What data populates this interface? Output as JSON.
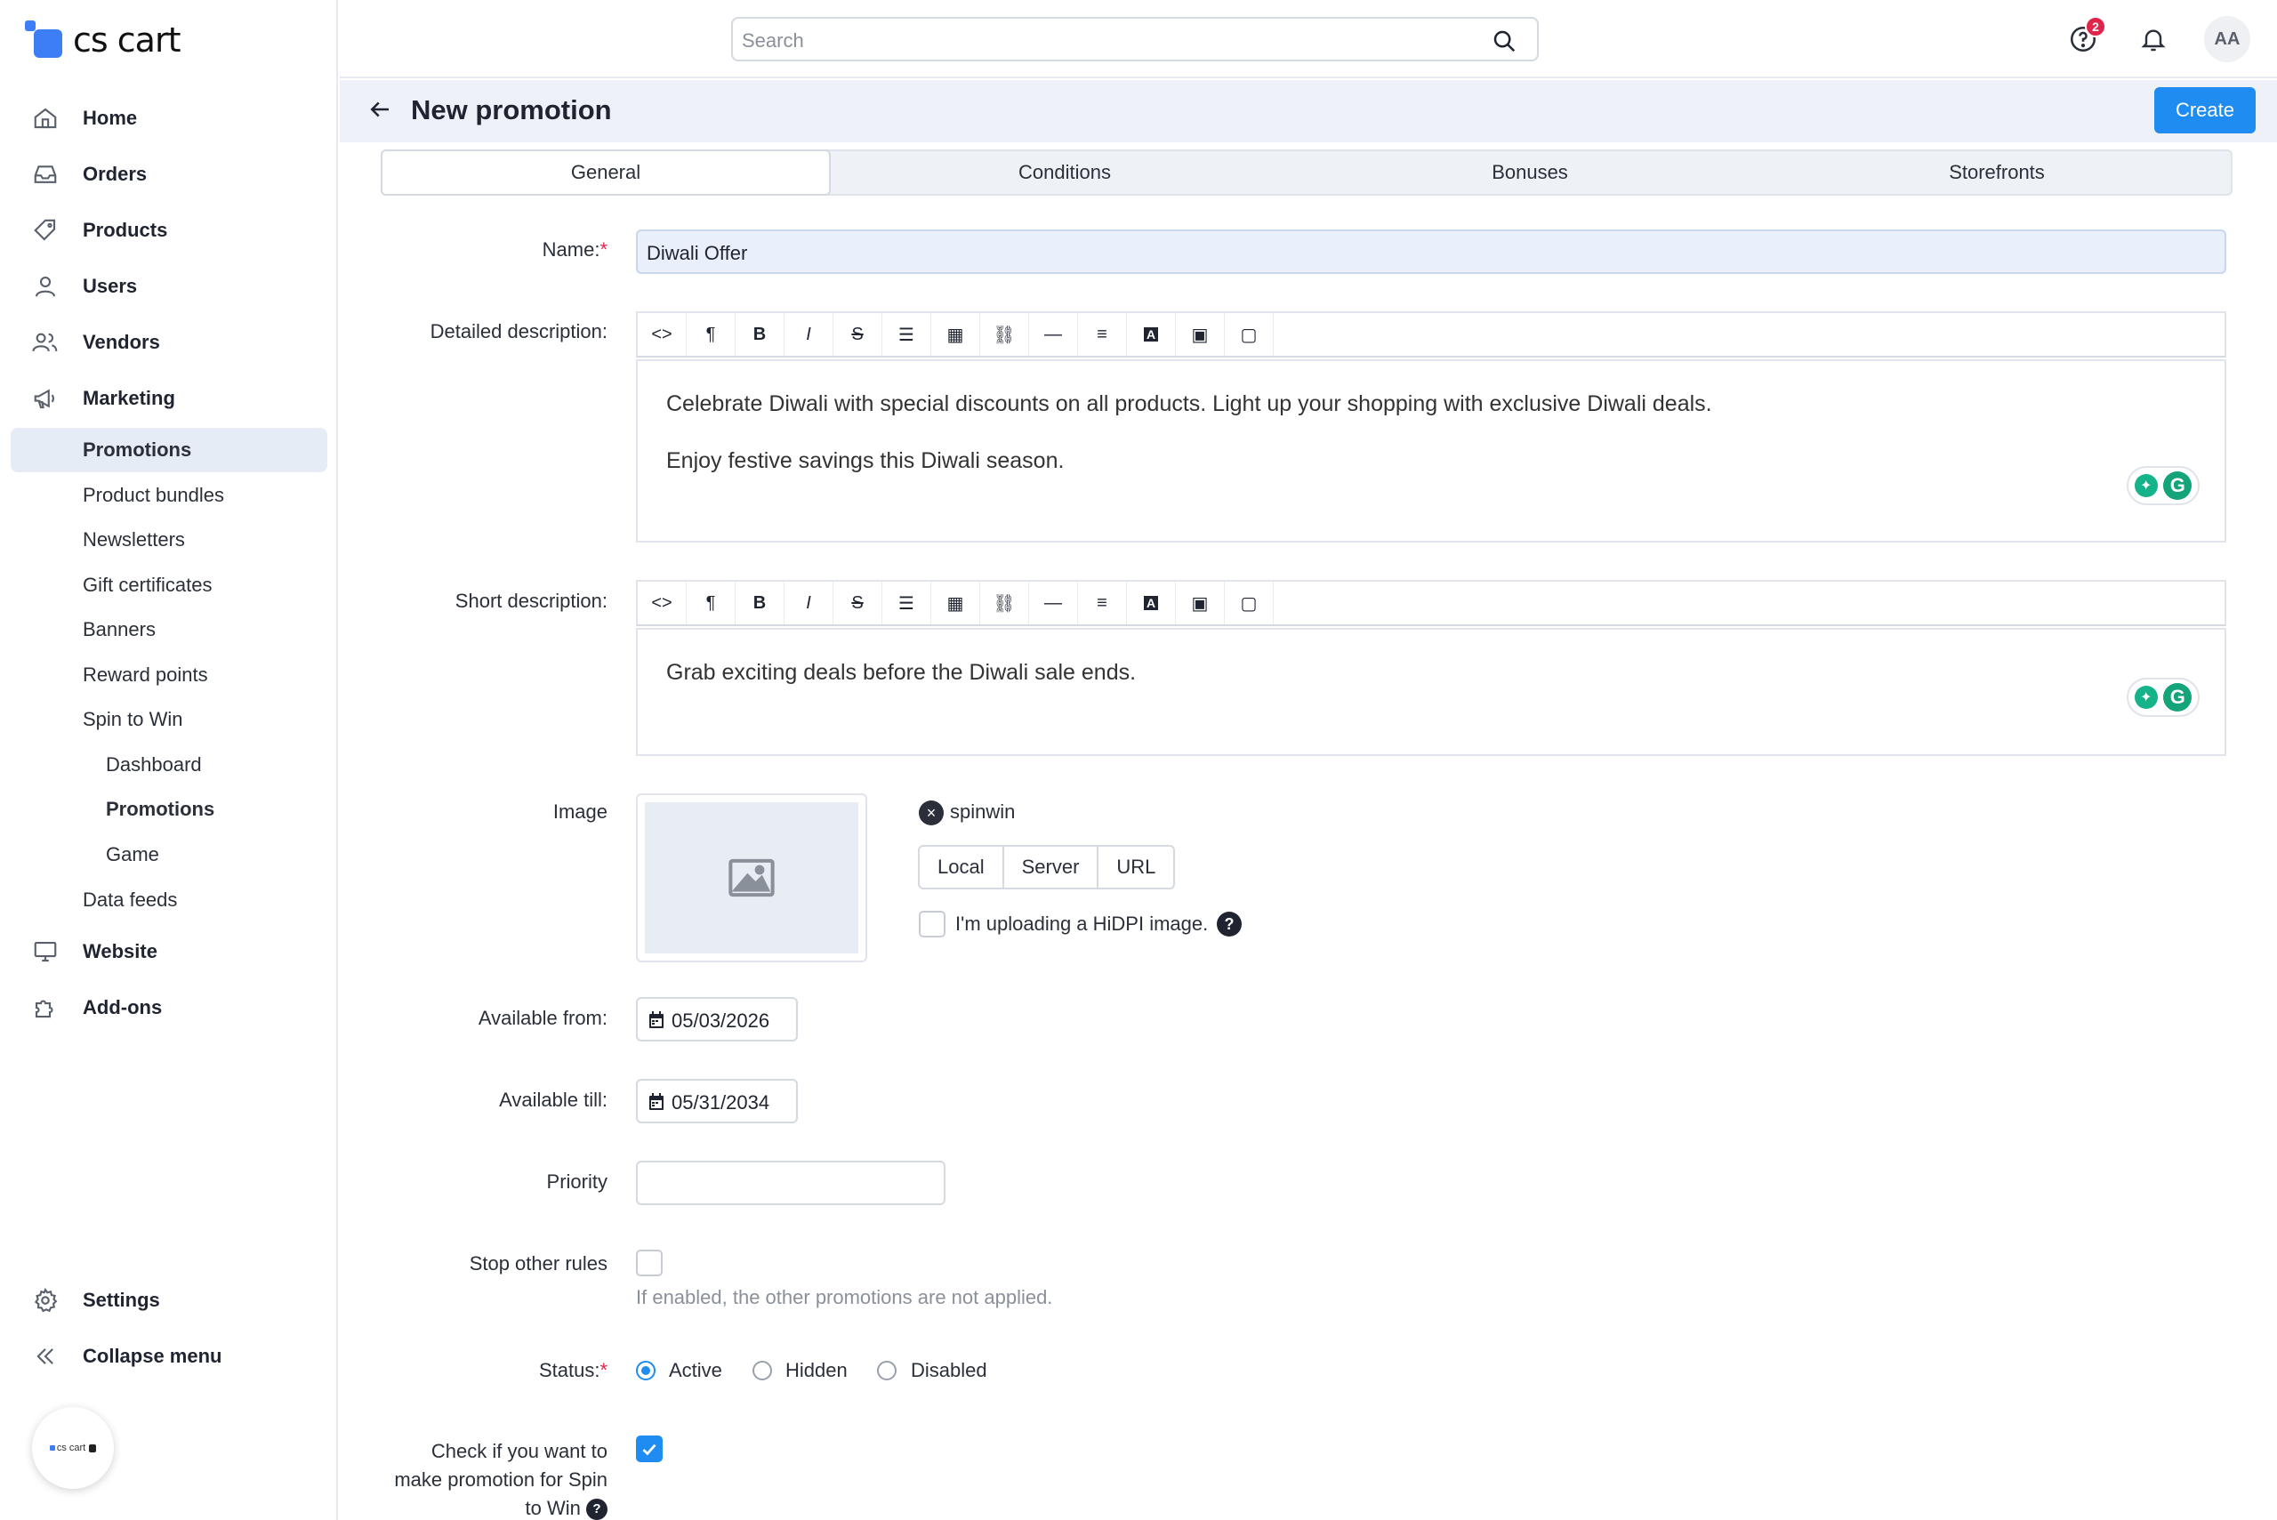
{
  "brand": {
    "name": "cs cart",
    "badge_tag": ""
  },
  "search": {
    "placeholder": "Search"
  },
  "topbar": {
    "notifications_count": "2",
    "user_initials": "AA"
  },
  "sidebar": {
    "items": [
      {
        "label": "Home",
        "icon": "home-icon"
      },
      {
        "label": "Orders",
        "icon": "inbox-icon"
      },
      {
        "label": "Products",
        "icon": "tag-icon"
      },
      {
        "label": "Users",
        "icon": "user-icon"
      },
      {
        "label": "Vendors",
        "icon": "users-icon"
      },
      {
        "label": "Marketing",
        "icon": "megaphone-icon"
      }
    ],
    "marketing_sub": [
      "Promotions",
      "Product bundles",
      "Newsletters",
      "Gift certificates",
      "Banners",
      "Reward points",
      "Spin to Win"
    ],
    "spin_sub": [
      "Dashboard",
      "Promotions",
      "Game"
    ],
    "data_feeds": "Data feeds",
    "website": "Website",
    "addons": "Add-ons",
    "settings": "Settings",
    "collapse": "Collapse menu"
  },
  "header": {
    "title": "New promotion",
    "create_label": "Create"
  },
  "tabs": [
    "General",
    "Conditions",
    "Bonuses",
    "Storefronts"
  ],
  "form": {
    "name_label": "Name:",
    "name_value": "Diwali Offer",
    "detailed_label": "Detailed description:",
    "detailed_p1": "Celebrate Diwali with special discounts on all products. Light up your shopping with exclusive Diwali deals.",
    "detailed_p2": "Enjoy festive savings this Diwali season.",
    "short_label": "Short description:",
    "short_p1": "Grab exciting deals before the Diwali sale ends.",
    "image_label": "Image",
    "file_name": "spinwin",
    "sources": [
      "Local",
      "Server",
      "URL"
    ],
    "hidpi_label": "I'm uploading a HiDPI image.",
    "available_from_label": "Available from:",
    "available_from": "05/03/2026",
    "available_till_label": "Available till:",
    "available_till": "05/31/2034",
    "priority_label": "Priority",
    "priority_value": "",
    "stop_rules_label": "Stop other rules",
    "stop_rules_hint": "If enabled, the other promotions are not applied.",
    "status_label": "Status:",
    "status_options": [
      "Active",
      "Hidden",
      "Disabled"
    ],
    "status_selected": "Active",
    "spin_label_1": "Check if you want to",
    "spin_label_2": "make promotion for Spin",
    "spin_label_3": "to Win",
    "spin_checked": true
  },
  "colors": {
    "accent": "#1e8cf0",
    "active_nav_bg": "#e6ecf6",
    "badge": "#e0244a"
  }
}
